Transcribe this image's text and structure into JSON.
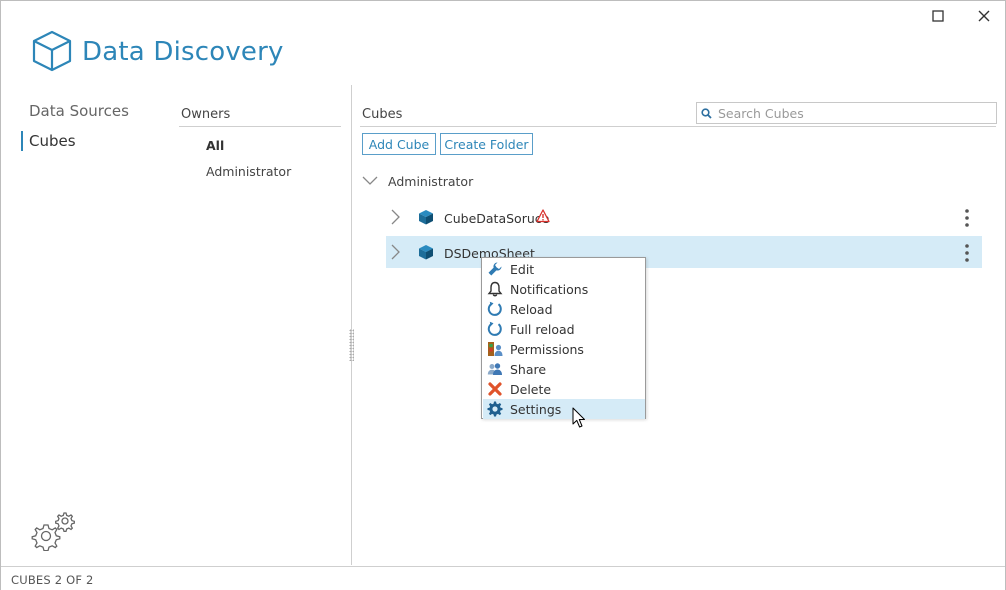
{
  "window": {
    "maximize_icon": "maximize-icon",
    "close_icon": "close-icon"
  },
  "app": {
    "title": "Data Discovery",
    "logo_icon": "cube-outline-icon",
    "accent_color": "#2d86b8"
  },
  "nav": {
    "items": [
      {
        "label": "Data Sources",
        "active": false
      },
      {
        "label": "Cubes",
        "active": true
      }
    ],
    "settings_icon": "gears-icon"
  },
  "owners": {
    "title": "Owners",
    "items": [
      {
        "label": "All",
        "selected": true
      },
      {
        "label": "Administrator",
        "selected": false
      }
    ]
  },
  "cubes": {
    "title": "Cubes",
    "search_placeholder": "Search Cubes",
    "add_button": "Add Cube",
    "create_folder_button": "Create Folder",
    "group": {
      "label": "Administrator",
      "expanded": true
    },
    "rows": [
      {
        "label": "CubeDataSoruce",
        "warning": true,
        "selected": false
      },
      {
        "label": "DSDemoSheet",
        "warning": false,
        "selected": true
      }
    ]
  },
  "context_menu": {
    "items": [
      {
        "label": "Edit",
        "icon": "wrench-icon"
      },
      {
        "label": "Notifications",
        "icon": "bell-icon"
      },
      {
        "label": "Reload",
        "icon": "reload-icon"
      },
      {
        "label": "Full reload",
        "icon": "full-reload-icon"
      },
      {
        "label": "Permissions",
        "icon": "permissions-icon"
      },
      {
        "label": "Share",
        "icon": "share-icon"
      },
      {
        "label": "Delete",
        "icon": "delete-icon"
      },
      {
        "label": "Settings",
        "icon": "gear-icon",
        "hovered": true
      }
    ]
  },
  "status": {
    "text": "CUBES 2 OF 2"
  }
}
